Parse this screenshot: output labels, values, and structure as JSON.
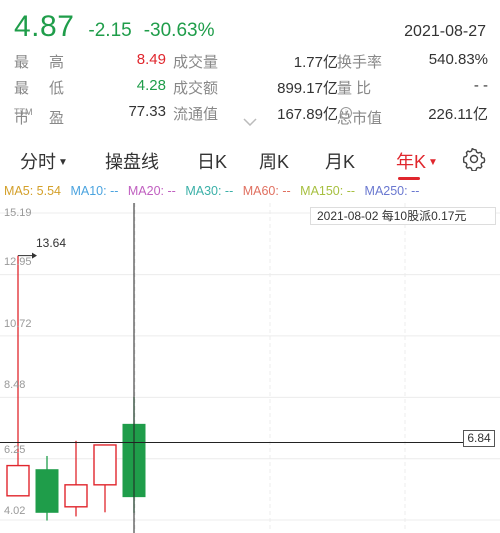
{
  "quote": {
    "price": "4.87",
    "change": "-2.15",
    "change_pct": "-30.63%",
    "date": "2021-08-27"
  },
  "stats": {
    "rows": [
      {
        "l1": "最高",
        "v1": "8.49",
        "l2": "成交量",
        "v2": "1.77亿",
        "l3": "换手率",
        "v3": "540.83%"
      },
      {
        "l1": "最低",
        "v1": "4.28",
        "l2": "成交额",
        "v2": "899.17亿",
        "l3": "量 比",
        "v3": "- -"
      },
      {
        "l1": "市盈",
        "l1_sup": "TTM",
        "v1": "77.33",
        "l2": "流通值",
        "v2": "167.89亿",
        "l3": "总市值",
        "v3": "226.11亿"
      }
    ]
  },
  "tabs": {
    "timeshare": "分时",
    "operate_line": "操盘线",
    "day": "日K",
    "week": "周K",
    "month": "月K",
    "year": "年K"
  },
  "ma": {
    "ma5": "MA5: 5.54",
    "ma10": "MA10: --",
    "ma20": "MA20: --",
    "ma30": "MA30: --",
    "ma60": "MA60: --",
    "ma150": "MA150: --",
    "ma250": "MA250: --"
  },
  "colors": {
    "up": "#e0262d",
    "down": "#1f9d4a",
    "ma5": "#d4a02a",
    "ma10": "#4aa3df",
    "ma20": "#c05fc0",
    "ma30": "#3bb0a8",
    "ma60": "#e07060",
    "ma150": "#a7c040",
    "ma250": "#6a78d0"
  },
  "chart_data": {
    "type": "candlestick",
    "y_ticks": [
      "15.19",
      "12.95",
      "10.72",
      "8.48",
      "6.25",
      "4.02"
    ],
    "ylim": [
      4.02,
      15.19
    ],
    "high_annotation": "13.64",
    "dividend_note": "2021-08-02  每10股派0.17元",
    "crosshair_price": "6.84",
    "candles": [
      {
        "open": 4.9,
        "close": 6.0,
        "high": 13.64,
        "low": 4.9,
        "dir": "up"
      },
      {
        "open": 5.85,
        "close": 4.3,
        "high": 6.35,
        "low": 4.0,
        "dir": "down"
      },
      {
        "open": 4.5,
        "close": 5.3,
        "high": 6.9,
        "low": 4.15,
        "dir": "up"
      },
      {
        "open": 5.3,
        "close": 6.75,
        "high": 6.75,
        "low": 4.3,
        "dir": "up"
      },
      {
        "open": 7.5,
        "close": 4.87,
        "high": 8.49,
        "low": 4.28,
        "dir": "down"
      }
    ]
  }
}
